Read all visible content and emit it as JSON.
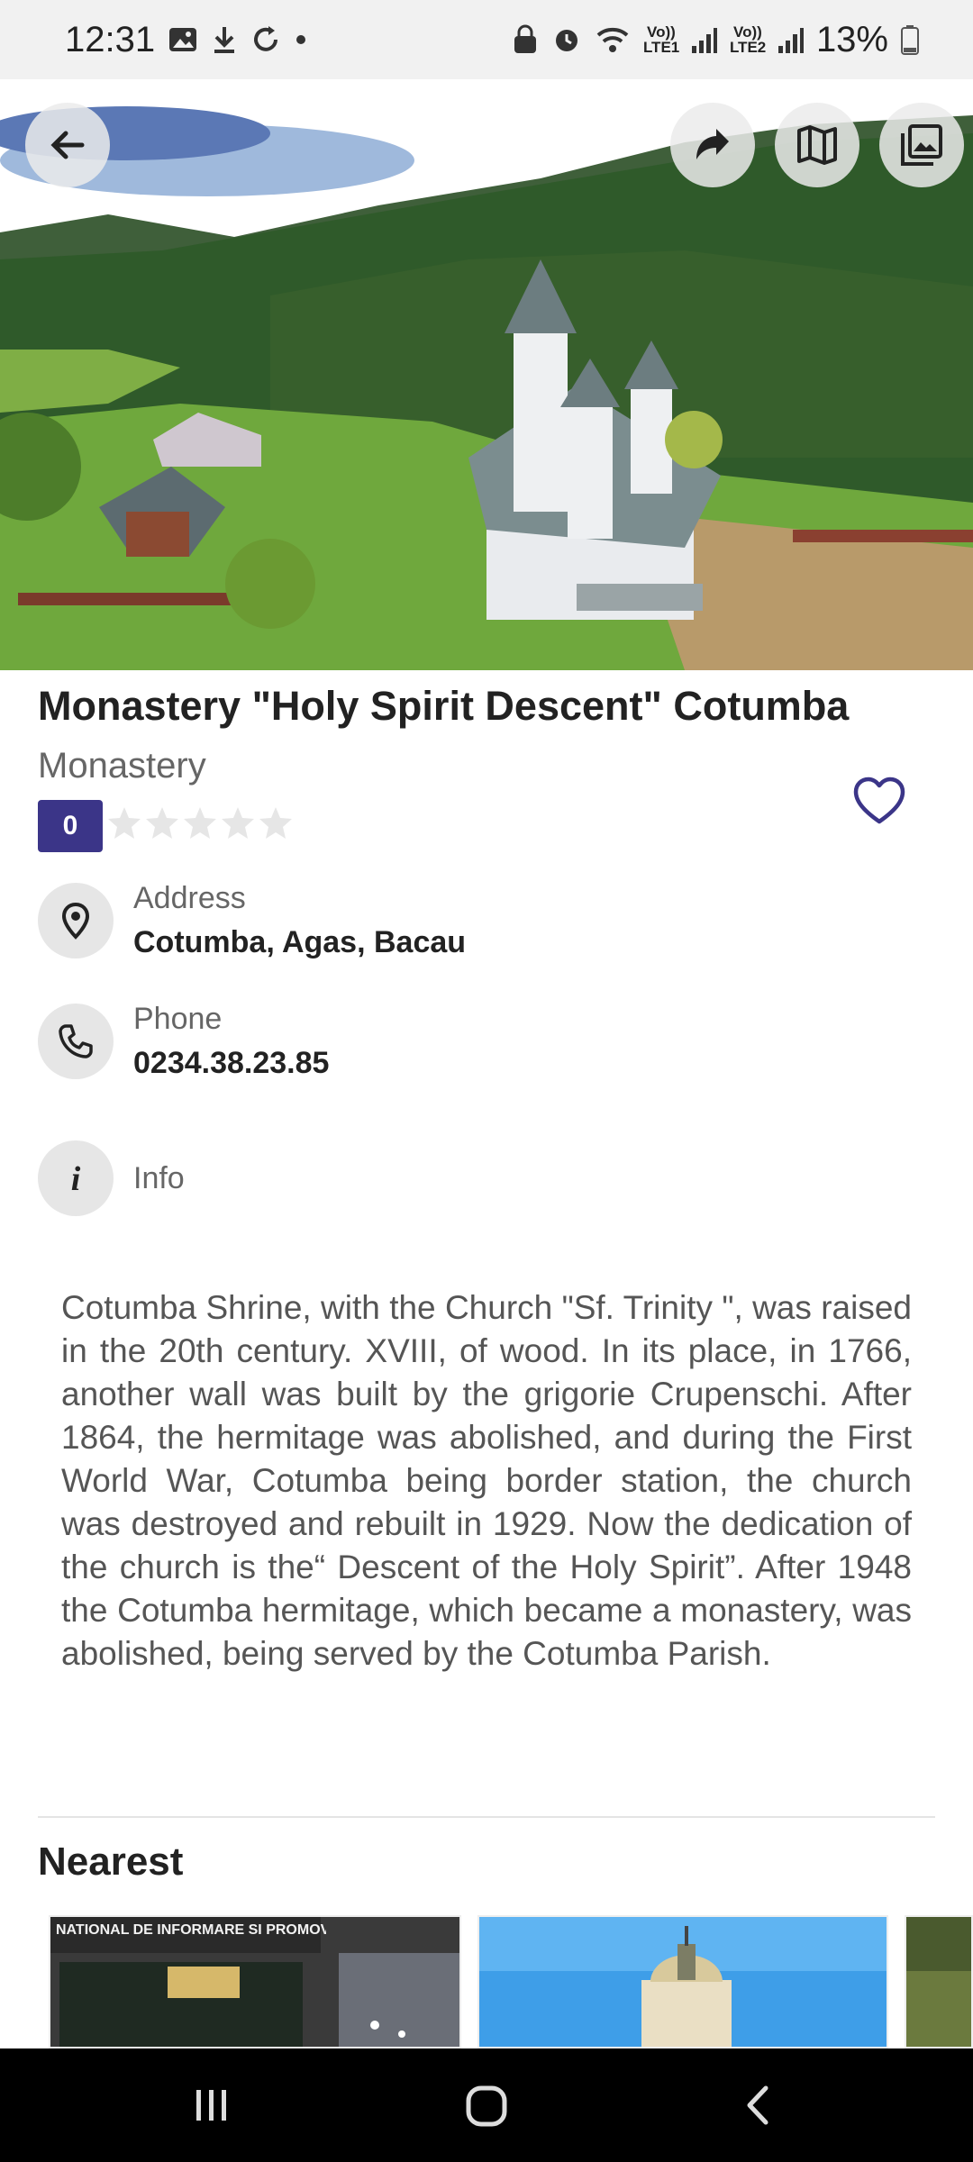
{
  "status_bar": {
    "time": "12:31",
    "battery": "13%",
    "net1": "Vo)) LTE1",
    "net2": "Vo)) LTE2"
  },
  "place": {
    "title": "Monastery \"Holy Spirit Descent\" Cotumba",
    "category": "Monastery",
    "rating": "0",
    "rating_stars_filled": 0
  },
  "address": {
    "label": "Address",
    "value": "Cotumba, Agas, Bacau"
  },
  "phone": {
    "label": "Phone",
    "value": "0234.38.23.85"
  },
  "info": {
    "label": "Info"
  },
  "description": "Cotumba Shrine, with the Church \"Sf. Trinity \", was raised in the 20th century. XVIII, of wood. In its place, in 1766, another wall was built by the grigorie Crupenschi. After 1864, the hermitage was abolished, and during the First World War, Cotumba being border station, the church was destroyed and rebuilt in 1929. Now the dedication of the church is the“ Descent of the Holy Spirit”. After 1948 the Cotumba hermitage, which became a monastery, was abolished, being served by the Cotumba Parish.",
  "nearest": {
    "title": "Nearest",
    "card1_sign": "NATIONAL DE INFORMARE SI PROMOVARE"
  },
  "colors": {
    "accent": "#3b3588",
    "grass": "#6fa83d",
    "forest": "#2f5a2a"
  },
  "icons": [
    "back-arrow-icon",
    "share-icon",
    "map-icon",
    "gallery-icon",
    "heart-icon",
    "location-pin-icon",
    "phone-icon",
    "info-icon"
  ]
}
